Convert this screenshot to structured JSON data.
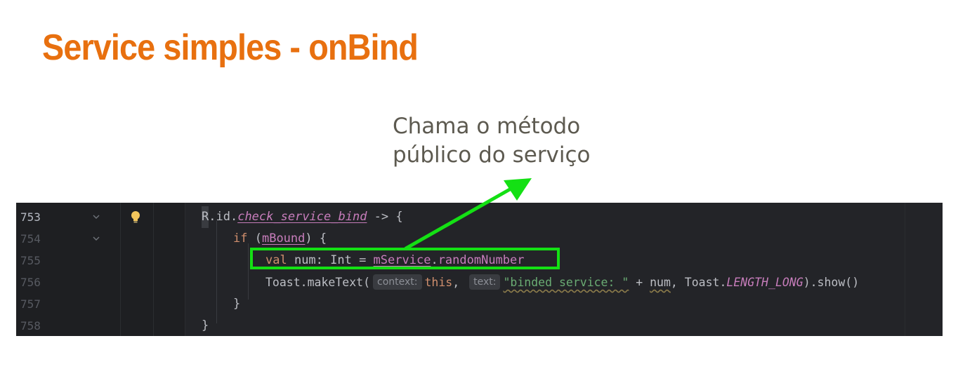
{
  "slide": {
    "title": "Service simples - onBind",
    "annotation": [
      "Chama o método",
      "público do serviço"
    ]
  },
  "editor": {
    "line_numbers": [
      "753",
      "754",
      "755",
      "756",
      "757",
      "758"
    ],
    "lines": [
      {
        "r": "R",
        "dot_id": ".id.",
        "ref": "check_service_bind",
        "rest": " -> {"
      },
      {
        "kw": "if",
        "open": " (",
        "var": "mBound",
        "close": ") {"
      },
      {
        "kw": "val",
        "decl": " num: Int = ",
        "obj": "mService",
        "dot": ".",
        "member": "randomNumber"
      },
      {
        "call": "Toast.makeText(",
        "hint1": "context:",
        "this_kw": "this",
        "comma": ",",
        "hint2": "text:",
        "str": "\"binded service: \"",
        "plus": " + ",
        "num": "num",
        "toast": ", Toast.",
        "const": "LENGTH_LONG",
        "end": ").show()"
      },
      {
        "text": "}"
      },
      {
        "text": "}"
      }
    ]
  },
  "colors": {
    "title": "#e8700f",
    "highlight": "#14e014",
    "editor_bg": "#1e1f22"
  },
  "icons": [
    "fold-chevron-icon",
    "lightbulb-icon",
    "arrow-icon"
  ]
}
